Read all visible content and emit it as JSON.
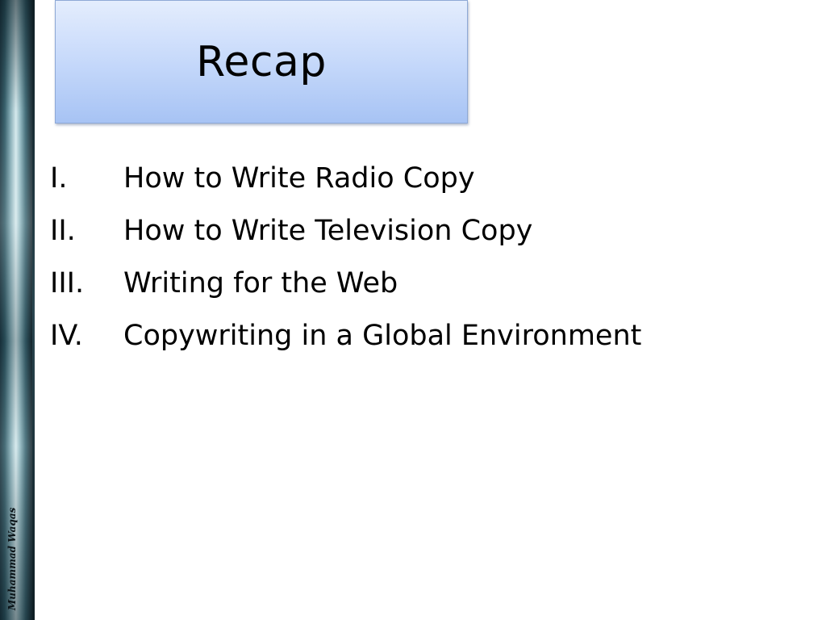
{
  "slide": {
    "title": "Recap",
    "author": "Muhammad Waqas",
    "items": [
      {
        "numeral": "I.",
        "text": "How to Write Radio Copy"
      },
      {
        "numeral": "II.",
        "text": "How to Write Television Copy"
      },
      {
        "numeral": "III.",
        "text": "Writing for the Web"
      },
      {
        "numeral": "IV.",
        "text": "Copywriting in a Global Environment"
      }
    ]
  },
  "colors": {
    "title_box_top": "#e4edfd",
    "title_box_bottom": "#a7c3f4",
    "side_strip_dark": "#1b3540",
    "side_strip_light": "#d3e8ec",
    "text": "#000000"
  }
}
